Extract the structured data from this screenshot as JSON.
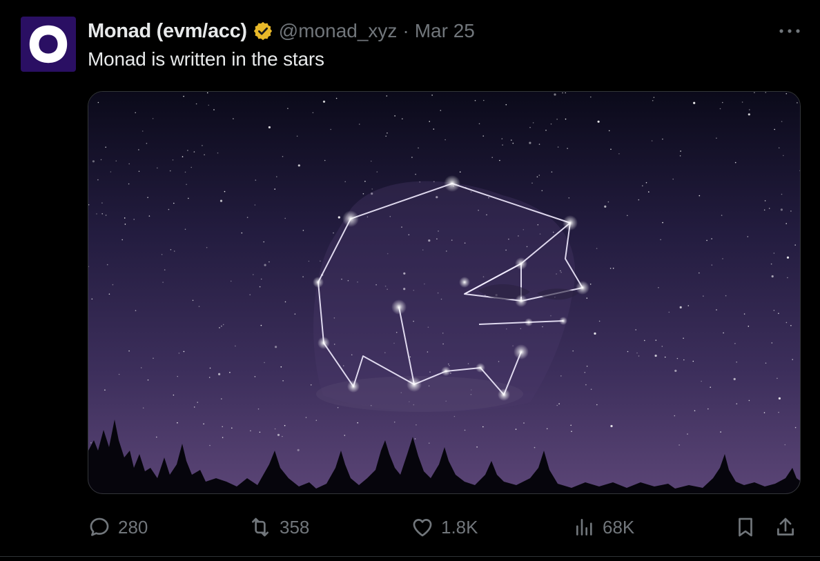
{
  "post": {
    "author_name": "Monad (evm/acc)",
    "handle": "@monad_xyz",
    "separator": "·",
    "date": "Mar 25",
    "text": "Monad is written in the stars"
  },
  "actions": {
    "replies": "280",
    "reposts": "358",
    "likes": "1.8K",
    "views": "68K"
  },
  "icons": {
    "avatar": "monad-logo-icon",
    "verified": "verified-badge-icon",
    "more": "more-icon",
    "reply": "reply-icon",
    "repost": "repost-icon",
    "like": "heart-icon",
    "views": "views-icon",
    "bookmark": "bookmark-icon",
    "share": "share-icon"
  },
  "colors": {
    "background": "#000000",
    "text": "#e7e9ea",
    "secondary": "#71767b",
    "verified_gold": "#e8b829",
    "avatar_bg": "#2a0f63"
  }
}
